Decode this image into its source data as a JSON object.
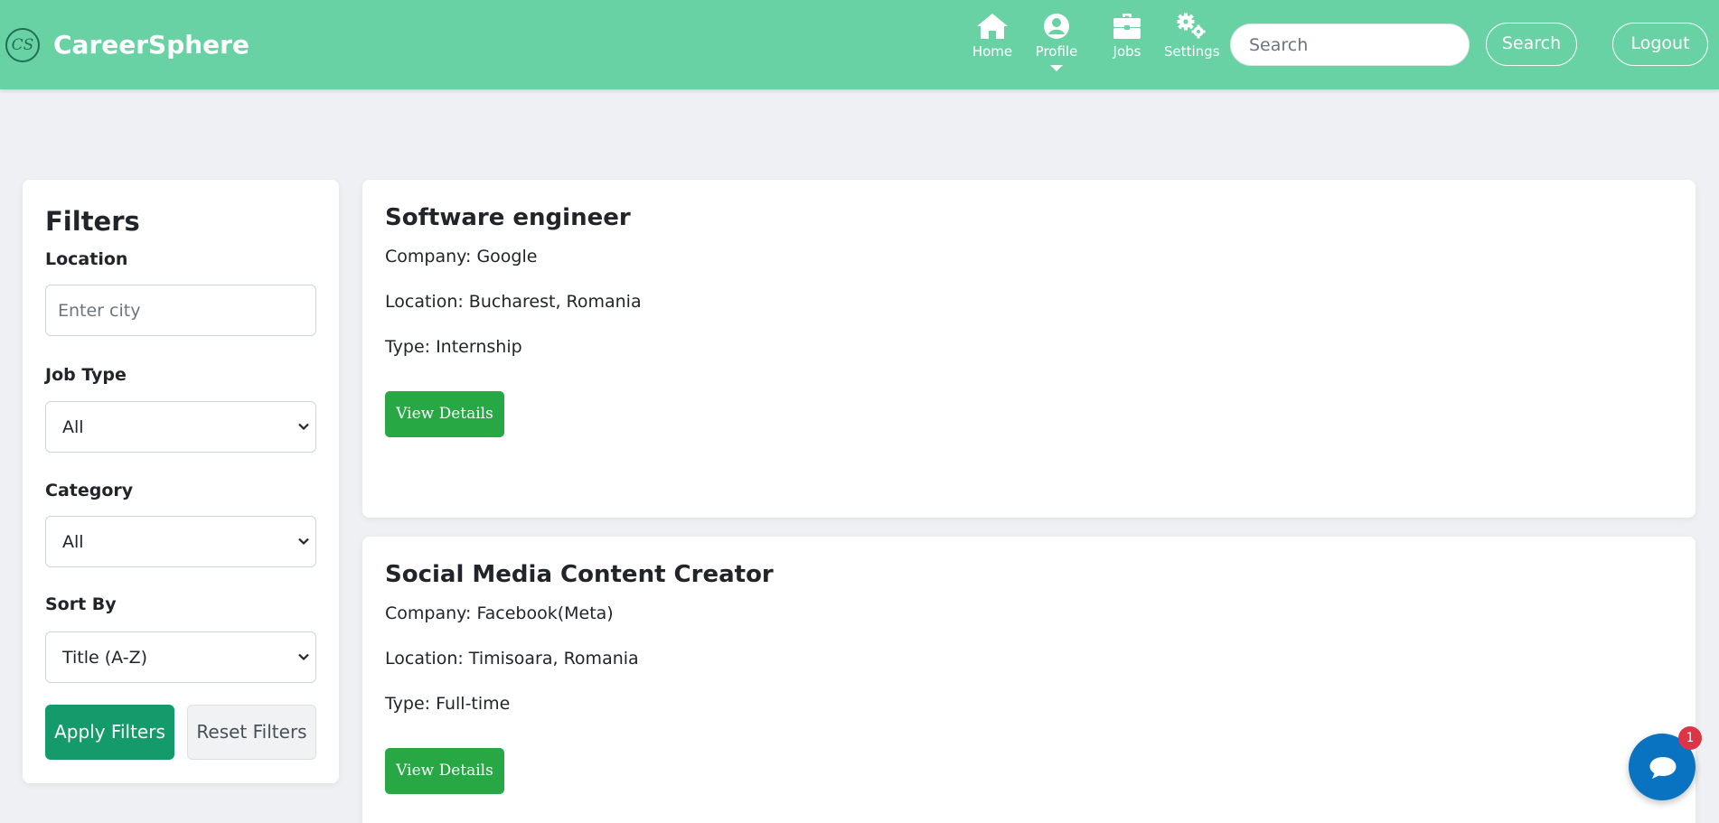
{
  "header": {
    "logo_text": "CS",
    "brand": "CareerSphere",
    "nav": [
      {
        "label": "Home",
        "icon": "home-icon"
      },
      {
        "label": "Profile",
        "icon": "user-circle-icon"
      },
      {
        "label": "Jobs",
        "icon": "briefcase-icon"
      },
      {
        "label": "Settings",
        "icon": "gears-icon"
      }
    ],
    "search_placeholder": "Search",
    "search_button": "Search",
    "logout_button": "Logout"
  },
  "filters": {
    "title": "Filters",
    "location_label": "Location",
    "location_placeholder": "Enter city",
    "job_type_label": "Job Type",
    "job_type_value": "All",
    "category_label": "Category",
    "category_value": "All",
    "sort_label": "Sort By",
    "sort_value": "Title (A-Z)",
    "apply_button": "Apply Filters",
    "reset_button": "Reset Filters"
  },
  "jobs": [
    {
      "title": "Software engineer",
      "company": "Company: Google",
      "location": "Location: Bucharest, Romania",
      "type": "Type: Internship",
      "button": "View Details"
    },
    {
      "title": "Social Media Content Creator",
      "company": "Company: Facebook(Meta)",
      "location": "Location: Timisoara, Romania",
      "type": "Type: Full-time",
      "button": "View Details"
    }
  ],
  "chat": {
    "badge_count": "1",
    "icon": "chat-bubble-icon"
  },
  "colors": {
    "navbar": "#69d2a5",
    "apply_button": "#159a6c",
    "view_details_button": "#28a745",
    "chat_button": "#0a73c1",
    "badge": "#dc3545"
  }
}
